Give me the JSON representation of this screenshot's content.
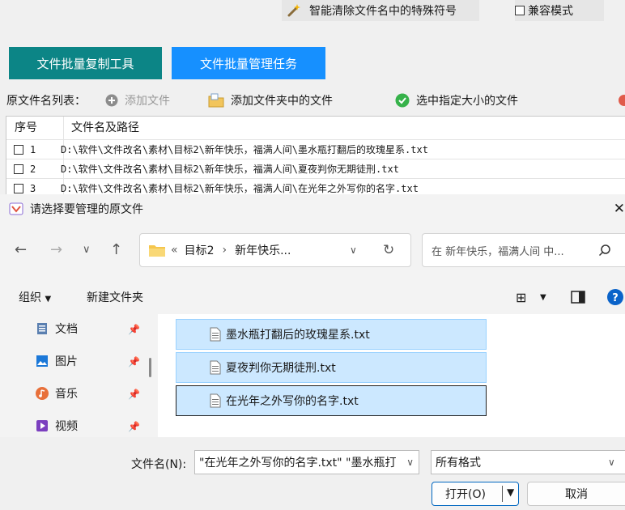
{
  "app": {
    "special_chars_button": "智能清除文件名中的特殊符号",
    "compat_mode_label": "兼容模式",
    "tabs": [
      {
        "label": "文件批量复制工具",
        "color": "#0c8586"
      },
      {
        "label": "文件批量管理任务",
        "color": "#1690ff"
      }
    ],
    "list_label": "原文件名列表：",
    "add_file": "添加文件",
    "add_folder": "添加文件夹中的文件",
    "select_size": "选中指定大小的文件",
    "table": {
      "headers": [
        "序号",
        "文件名及路径"
      ],
      "rows": [
        {
          "num": "1",
          "path": "D:\\软件\\文件改名\\素材\\目标2\\新年快乐，福满人间\\墨水瓶打翻后的玫瑰星系.txt"
        },
        {
          "num": "2",
          "path": "D:\\软件\\文件改名\\素材\\目标2\\新年快乐，福满人间\\夏夜判你无期徒刑.txt"
        },
        {
          "num": "3",
          "path": "D:\\软件\\文件改名\\素材\\目标2\\新年快乐，福满人间\\在光年之外写你的名字.txt"
        }
      ]
    }
  },
  "dialog": {
    "title": "请选择要管理的原文件",
    "breadcrumb": {
      "prefix": "«",
      "items": [
        "目标2",
        "新年快乐..."
      ]
    },
    "search_placeholder": "在 新年快乐，福满人间 中...",
    "organize": "组织",
    "new_folder": "新建文件夹",
    "nav_items": [
      {
        "label": "文档",
        "icon": "document-icon"
      },
      {
        "label": "图片",
        "icon": "picture-icon"
      },
      {
        "label": "音乐",
        "icon": "music-icon"
      },
      {
        "label": "视频",
        "icon": "video-icon"
      }
    ],
    "files": [
      "墨水瓶打翻后的玫瑰星系.txt",
      "夏夜判你无期徒刑.txt",
      "在光年之外写你的名字.txt"
    ],
    "filename_label": "文件名(N):",
    "filename_value": "\"在光年之外写你的名字.txt\" \"墨水瓶打",
    "filetype_value": "所有格式",
    "open_button": "打开(O)",
    "cancel_button": "取消"
  }
}
